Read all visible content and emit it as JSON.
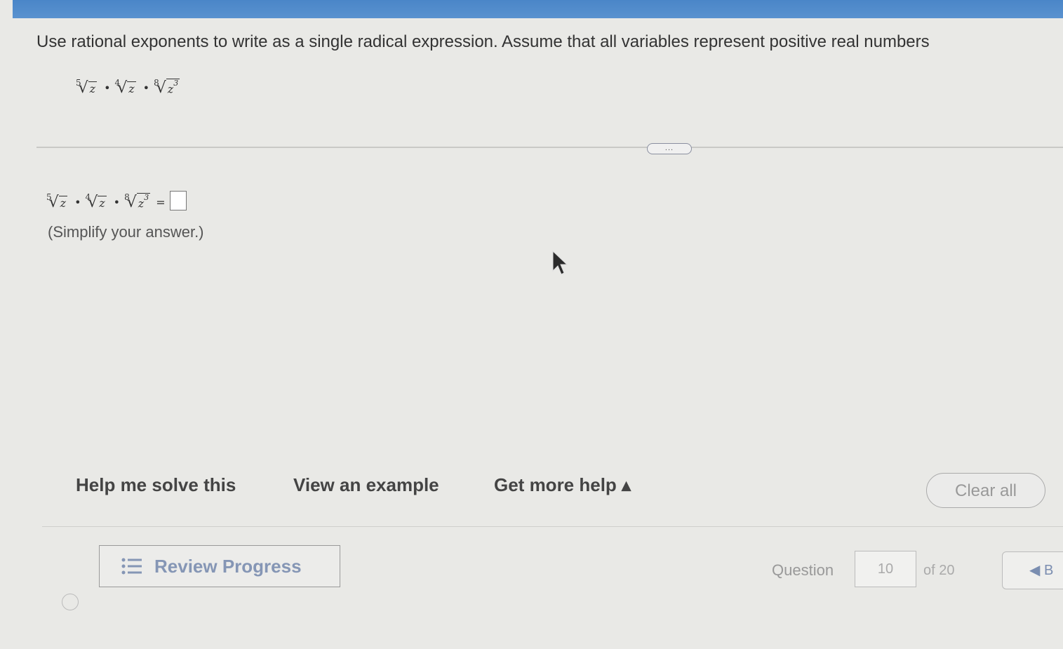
{
  "instructions": "Use rational exponents to write as a single radical expression. Assume that all variables represent positive real numbers",
  "problem": {
    "terms": [
      {
        "index": "5",
        "radicand": "z",
        "exponent": ""
      },
      {
        "index": "4",
        "radicand": "z",
        "exponent": ""
      },
      {
        "index": "8",
        "radicand": "z",
        "exponent": "3"
      }
    ],
    "operator": "•"
  },
  "more_button_label": "...",
  "answer": {
    "equals": "=",
    "value": ""
  },
  "hint": "(Simplify your answer.)",
  "help": {
    "help_me_solve": "Help me solve this",
    "view_example": "View an example",
    "get_more_help": "Get more help ▴",
    "clear_all": "Clear all"
  },
  "footer": {
    "review_progress": "Review Progress",
    "question_label": "Question",
    "question_number": "10",
    "of_label": "of 20",
    "nav_prev": "◀ B"
  },
  "colors": {
    "topbar": "#4a86c8",
    "accent_text": "#8596b5"
  }
}
